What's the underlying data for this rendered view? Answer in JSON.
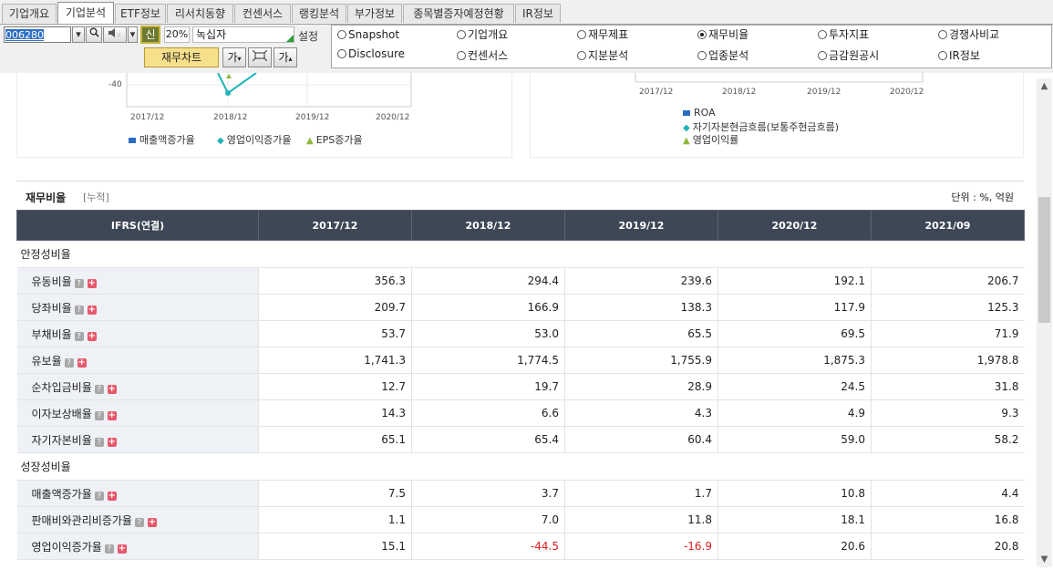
{
  "tabs": [
    "기업개요",
    "기업분석",
    "ETF정보",
    "리서치동향",
    "컨센서스",
    "랭킹분석",
    "부가정보",
    "종목별증자예정현황",
    "IR정보"
  ],
  "toolbar": {
    "stock_code": "006280",
    "new_label": "신",
    "percent": "20%",
    "stock_name": "녹십자",
    "setting_label": "설정",
    "chart_button": "재무차트",
    "font_button": "가",
    "font_button2": "가"
  },
  "radio_options": [
    {
      "label": "Snapshot",
      "selected": false
    },
    {
      "label": "기업개요",
      "selected": false
    },
    {
      "label": "재무제표",
      "selected": false
    },
    {
      "label": "재무비율",
      "selected": true
    },
    {
      "label": "투자지표",
      "selected": false
    },
    {
      "label": "경쟁사비교",
      "selected": false
    },
    {
      "label": "Disclosure",
      "selected": false
    },
    {
      "label": "컨센서스",
      "selected": false
    },
    {
      "label": "지분분석",
      "selected": false
    },
    {
      "label": "업종분석",
      "selected": false
    },
    {
      "label": "금감원공시",
      "selected": false
    },
    {
      "label": "IR정보",
      "selected": false
    }
  ],
  "left_chart": {
    "y_tick": "-40",
    "x_ticks": [
      "2017/12",
      "2018/12",
      "2019/12",
      "2020/12"
    ],
    "legend": [
      "매출액증가율",
      "영업이익증가율",
      "EPS증가율"
    ]
  },
  "right_chart": {
    "x_ticks": [
      "2017/12",
      "2018/12",
      "2019/12",
      "2020/12"
    ],
    "legend": [
      "ROA",
      "자기자본현금흐름(보통주현금흐름)",
      "영업이익률"
    ]
  },
  "section": {
    "title": "재무비율",
    "subtitle": "[누적]",
    "unit": "단위 : %, 억원"
  },
  "table": {
    "header": [
      "IFRS(연결)",
      "2017/12",
      "2018/12",
      "2019/12",
      "2020/12",
      "2021/09"
    ],
    "groups": [
      {
        "category": "안정성비율",
        "rows": [
          {
            "label": "유동비율",
            "values": [
              "356.3",
              "294.4",
              "239.6",
              "192.1",
              "206.7"
            ]
          },
          {
            "label": "당좌비율",
            "values": [
              "209.7",
              "166.9",
              "138.3",
              "117.9",
              "125.3"
            ]
          },
          {
            "label": "부채비율",
            "values": [
              "53.7",
              "53.0",
              "65.5",
              "69.5",
              "71.9"
            ]
          },
          {
            "label": "유보율",
            "values": [
              "1,741.3",
              "1,774.5",
              "1,755.9",
              "1,875.3",
              "1,978.8"
            ]
          },
          {
            "label": "순차입금비율",
            "values": [
              "12.7",
              "19.7",
              "28.9",
              "24.5",
              "31.8"
            ]
          },
          {
            "label": "이자보상배율",
            "values": [
              "14.3",
              "6.6",
              "4.3",
              "4.9",
              "9.3"
            ]
          },
          {
            "label": "자기자본비율",
            "values": [
              "65.1",
              "65.4",
              "60.4",
              "59.0",
              "58.2"
            ]
          }
        ]
      },
      {
        "category": "성장성비율",
        "rows": [
          {
            "label": "매출액증가율",
            "values": [
              "7.5",
              "3.7",
              "1.7",
              "10.8",
              "4.4"
            ]
          },
          {
            "label": "판매비와관리비증가율",
            "values": [
              "1.1",
              "7.0",
              "11.8",
              "18.1",
              "16.8"
            ]
          },
          {
            "label": "영업이익증가율",
            "values": [
              "15.1",
              "-44.5",
              "-16.9",
              "20.6",
              "20.8"
            ]
          }
        ]
      }
    ]
  },
  "colors": {
    "header_bg": "#3d4756",
    "negative": "#e01e1e",
    "label_bg": "#eef1f6",
    "legend_blue": "#2b6cc4",
    "legend_teal": "#1fb3b8",
    "legend_green": "#8cb83c"
  }
}
